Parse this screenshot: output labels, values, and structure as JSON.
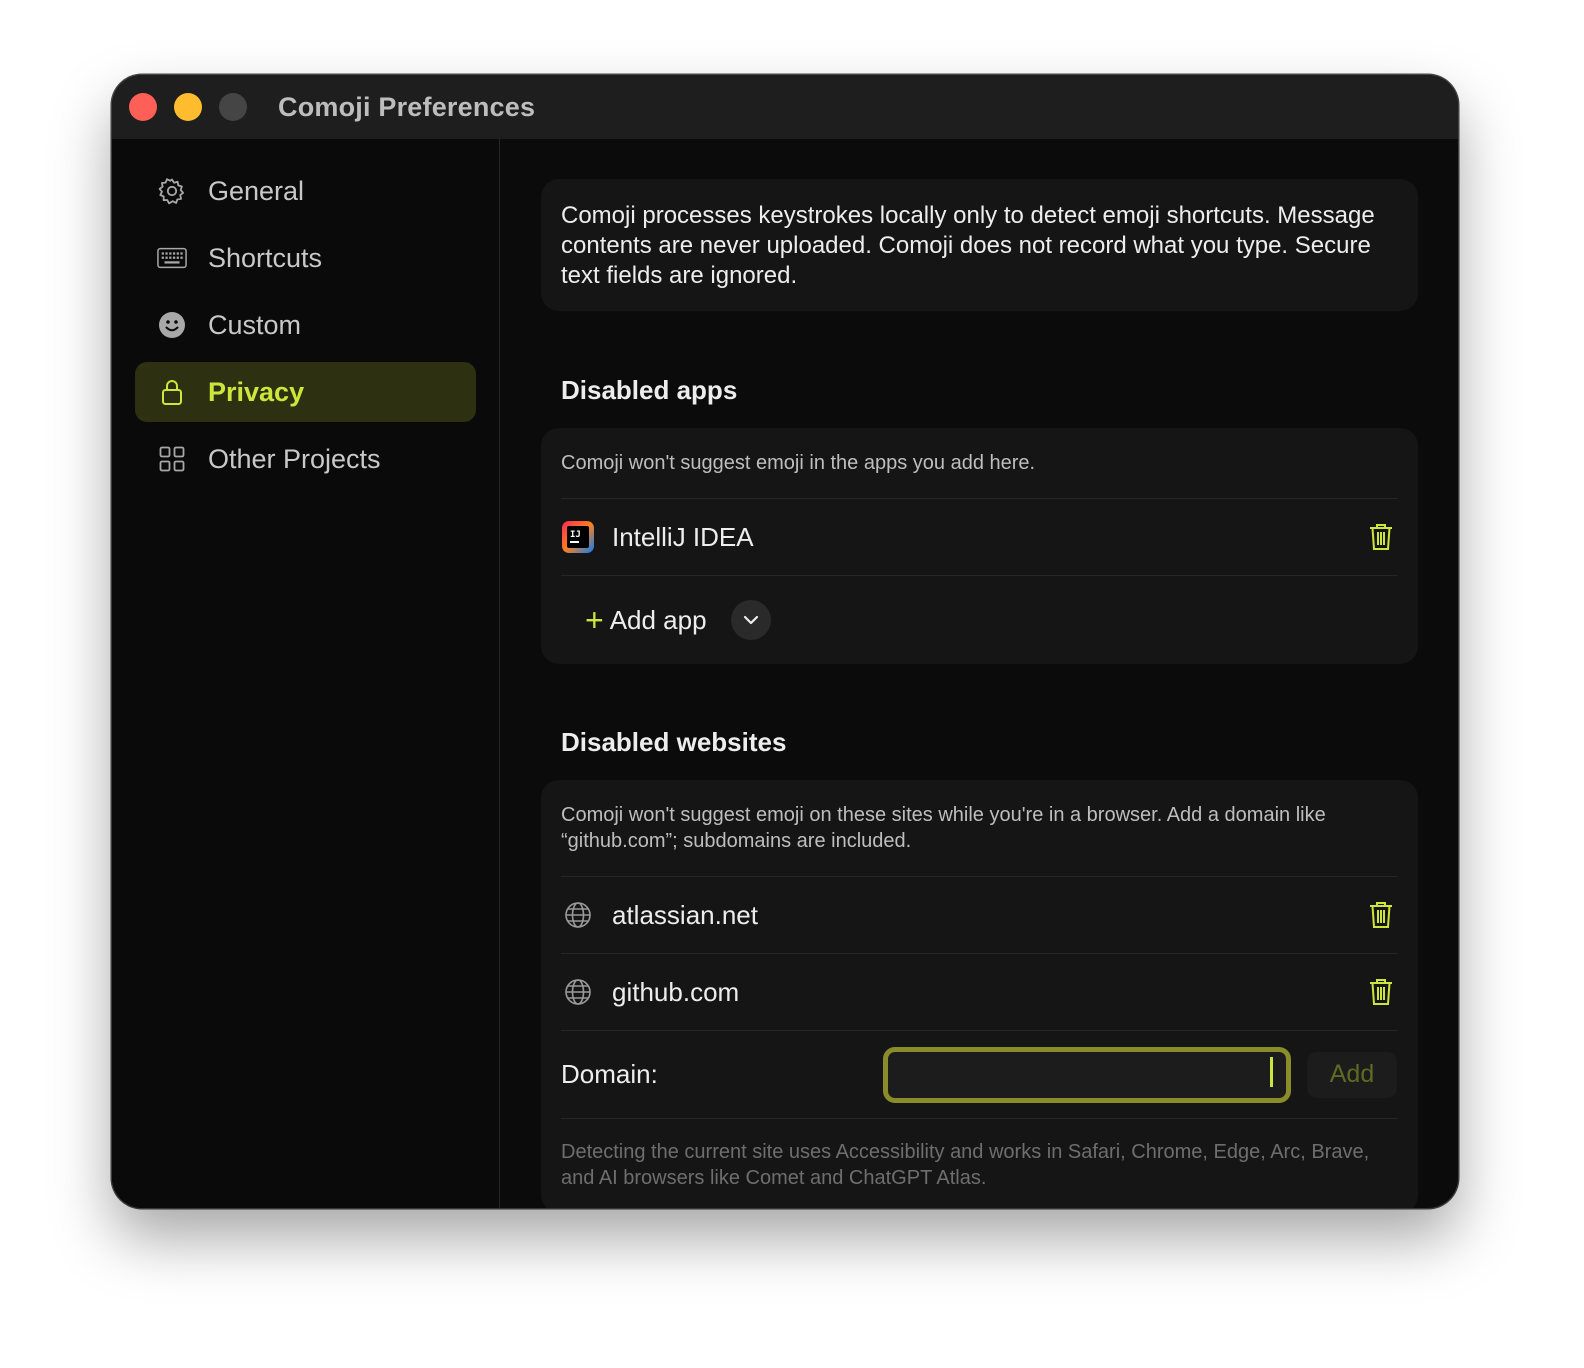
{
  "window": {
    "title": "Comoji Preferences"
  },
  "sidebar": {
    "items": [
      {
        "label": "General",
        "icon": "gear-icon"
      },
      {
        "label": "Shortcuts",
        "icon": "keyboard-icon"
      },
      {
        "label": "Custom",
        "icon": "smiley-icon"
      },
      {
        "label": "Privacy",
        "icon": "lock-icon",
        "active": true
      },
      {
        "label": "Other Projects",
        "icon": "grid-icon"
      }
    ]
  },
  "privacy": {
    "intro": "Comoji processes keystrokes locally only to detect emoji shortcuts. Message contents are never uploaded. Comoji does not record what you type. Secure text fields are ignored.",
    "disabled_apps": {
      "title": "Disabled apps",
      "description": "Comoji won't suggest emoji in the apps you add here.",
      "apps": [
        {
          "name": "IntelliJ IDEA",
          "icon": "intellij-app-icon"
        }
      ],
      "add_label": "Add app"
    },
    "disabled_websites": {
      "title": "Disabled websites",
      "description": "Comoji won't suggest emoji on these sites while you're in a browser. Add a domain like “github.com”; subdomains are included.",
      "sites": [
        {
          "domain": "atlassian.net",
          "icon": "globe-icon"
        },
        {
          "domain": "github.com",
          "icon": "globe-icon"
        }
      ],
      "domain_label": "Domain:",
      "domain_value": "",
      "add_button": "Add",
      "footnote": "Detecting the current site uses Accessibility and works in Safari, Chrome, Edge, Arc, Brave, and AI browsers like Comet and ChatGPT Atlas."
    }
  },
  "colors": {
    "accent": "#cde63b",
    "active_bg": "#2d3111",
    "close": "#fe5f57",
    "minimize": "#febc2e"
  }
}
